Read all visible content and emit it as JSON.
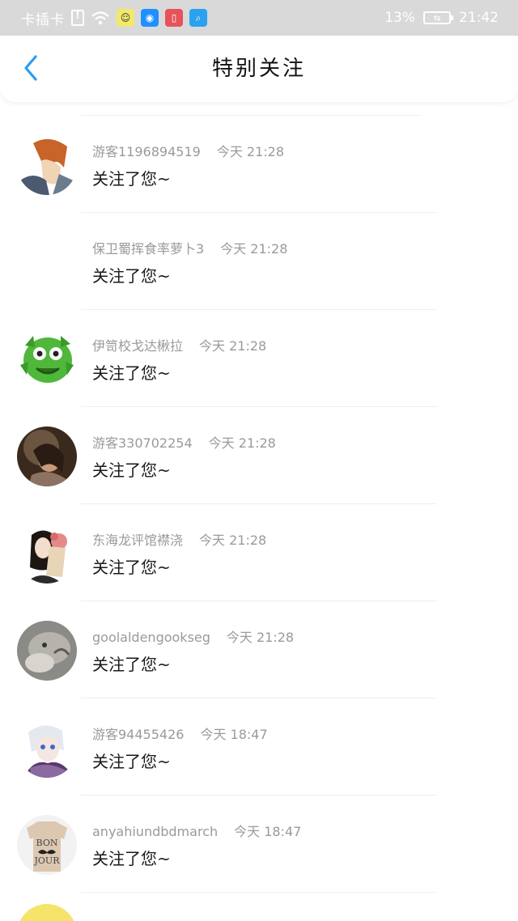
{
  "status_bar": {
    "carrier": "卡插卡",
    "battery": "13%",
    "time": "21:42",
    "icons": [
      "sim-alert-icon",
      "wifi-icon",
      "app-icon-face",
      "app-icon-bulb",
      "app-icon-book",
      "app-icon-search"
    ]
  },
  "header": {
    "title": "特别关注",
    "back_icon": "chevron-left-icon",
    "accent_color": "#2a9df4"
  },
  "notifications": [
    {
      "name": "游客1196894519",
      "time": "今天 21:28",
      "message": "关注了您~",
      "avatar": "anime-orange-hair"
    },
    {
      "name": "保卫蜀挥食率萝卜3",
      "time": "今天 21:28",
      "message": "关注了您~",
      "avatar": "blank"
    },
    {
      "name": "伊笥校戈达楸拉",
      "time": "今天 21:28",
      "message": "关注了您~",
      "avatar": "green-monster"
    },
    {
      "name": "游客330702254",
      "time": "今天 21:28",
      "message": "关注了您~",
      "avatar": "girl-photo"
    },
    {
      "name": "东海龙评馆襟浇",
      "time": "今天 21:28",
      "message": "关注了您~",
      "avatar": "girl-flowers"
    },
    {
      "name": "goolaldengookseg",
      "time": "今天 21:28",
      "message": "关注了您~",
      "avatar": "cat-photo"
    },
    {
      "name": "游客94455426",
      "time": "今天 18:47",
      "message": "关注了您~",
      "avatar": "anime-white-hair"
    },
    {
      "name": "anyahiundbdmarch",
      "time": "今天 18:47",
      "message": "关注了您~",
      "avatar": "bonjour-shirt"
    }
  ]
}
